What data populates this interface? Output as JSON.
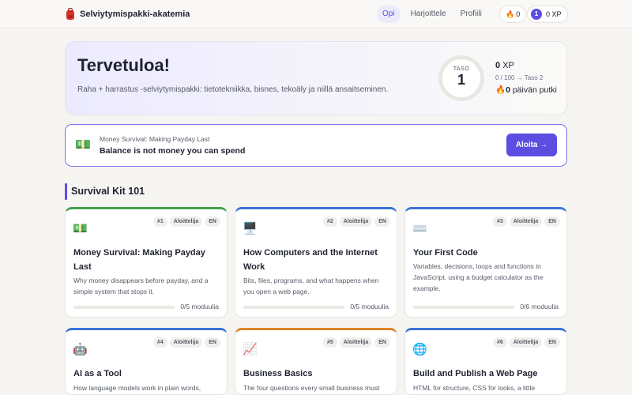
{
  "nav": {
    "brand": "Selviytymispakki-akatemia",
    "tabs": [
      "Opi",
      "Harjoittele",
      "Profiili"
    ],
    "streak": "0",
    "level_badge": "1",
    "xp": "0 XP"
  },
  "hero": {
    "title": "Tervetuloa!",
    "subtitle": "Raha + harrastus -selviytymispakki: tietotekniikka, bisnes, tekoäly ja niillä ansaitseminen.",
    "level_label": "TASO",
    "level": "1",
    "xp_value": "0",
    "xp_unit": "XP",
    "xp_progress": "0 / 100 → Taso 2",
    "streak_value": "0",
    "streak_label": "päivän putki"
  },
  "banner": {
    "emoji": "💵",
    "kicker": "Money Survival: Making Payday Last",
    "title": "Balance is not money you can spend",
    "button": "Aloita →"
  },
  "section": {
    "title": "Survival Kit 101"
  },
  "cards": [
    {
      "emoji": "💵",
      "number": "#1",
      "level": "Aloittelija",
      "lang": "EN",
      "title": "Money Survival: Making Payday Last",
      "desc": "Why money disappears before payday, and a simple system that stops it.",
      "progress_text": "0/5 moduulia",
      "progress": 0
    },
    {
      "emoji": "🖥️",
      "number": "#2",
      "level": "Aloittelija",
      "lang": "EN",
      "title": "How Computers and the Internet Work",
      "desc": "Bits, files, programs, and what happens when you open a web page.",
      "progress_text": "0/5 moduulia",
      "progress": 0
    },
    {
      "emoji": "⌨️",
      "number": "#3",
      "level": "Aloittelija",
      "lang": "EN",
      "title": "Your First Code",
      "desc": "Variables, decisions, loops and functions in JavaScript, using a budget calculator as the example.",
      "progress_text": "0/6 moduulia",
      "progress": 0
    },
    {
      "emoji": "🤖",
      "number": "#4",
      "level": "Aloittelija",
      "lang": "EN",
      "title": "AI as a Tool",
      "desc": "How language models work in plain words,"
    },
    {
      "emoji": "📈",
      "number": "#5",
      "level": "Aloittelija",
      "lang": "EN",
      "title": "Business Basics",
      "desc": "The four questions every small business must"
    },
    {
      "emoji": "🌐",
      "number": "#6",
      "level": "Aloittelija",
      "lang": "EN",
      "title": "Build and Publish a Web Page",
      "desc": "HTML for structure, CSS for looks, a little"
    }
  ],
  "colors": {
    "accent": "#5b4ee0",
    "card_top_green": "#42a34a",
    "card_top_blue": "#3a73d8",
    "card_top_orange": "#e0842a"
  }
}
